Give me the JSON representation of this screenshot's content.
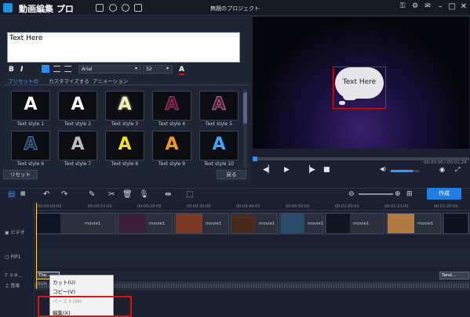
{
  "app": {
    "name": "動画編集 プロ",
    "window_title": "無題のプロジェクト"
  },
  "title_icons": [
    "save-icon",
    "help-icon",
    "info-icon",
    "menu-icon"
  ],
  "window_icons": [
    "key-icon",
    "settings-icon",
    "chat-icon",
    "minimize-icon",
    "maximize-icon",
    "close-icon"
  ],
  "window_glyphs": {
    "minimize": "–",
    "maximize": "□",
    "close": "✕"
  },
  "text_editor": {
    "value": "Text Here",
    "bold": "B",
    "italic": "I",
    "font": "Arial",
    "size": "32",
    "color_label": "A",
    "font_arrow": "▾",
    "size_arrow": "▾"
  },
  "tabs": [
    {
      "label": "プリセットの"
    },
    {
      "label": "カスタマイズする"
    },
    {
      "label": "アニメーション"
    }
  ],
  "styles": [
    {
      "label": "Text style 1",
      "color": "#ffffff"
    },
    {
      "label": "Text style 2",
      "color": "#ffffff"
    },
    {
      "label": "Text style 3",
      "color": "#f3ecc8"
    },
    {
      "label": "Text style 4",
      "color": "#4a1830"
    },
    {
      "label": "Text style 5",
      "color": "#4b1d3a"
    },
    {
      "label": "Text style 6",
      "color": "#1c2c40"
    },
    {
      "label": "Text style 7",
      "color": "#bdbdbd"
    },
    {
      "label": "Text style 8",
      "color": "#f5e21a"
    },
    {
      "label": "Text style 9",
      "color": "#f39b12"
    },
    {
      "label": "Text style 10",
      "color": "#3aa6ff"
    }
  ],
  "glyph_A": "A",
  "buttons": {
    "reset": "リセット",
    "back": "戻る",
    "create": "作成"
  },
  "preview": {
    "text": "Text Here",
    "time": "00:00:00 / 00:01:24"
  },
  "tracks": {
    "video": "ビデオ",
    "pip": "PIP1",
    "text": "テキ...",
    "audio": "音楽"
  },
  "ruler": [
    "00:00:00:00",
    "00:00:10:00",
    "00:00:20:00",
    "00:00:30:00",
    "00:00:40:00",
    "00:00:50:00",
    "00:01:00:00",
    "00:01:10:00",
    "00:01:20:00"
  ],
  "clip_label": "movie1",
  "text_clips": [
    "The...",
    "Tand..."
  ],
  "audio_clip": "BGM",
  "context_menu": [
    {
      "label": "カット(U)",
      "enabled": true
    },
    {
      "label": "コピー(V)",
      "enabled": true
    },
    {
      "label": "ペースト(W)",
      "enabled": false
    },
    {
      "label": "編集(X)",
      "enabled": true
    }
  ],
  "colors": {
    "accent": "#2d8cff",
    "highlight": "#e01010",
    "playhead": "#ffd23a"
  }
}
